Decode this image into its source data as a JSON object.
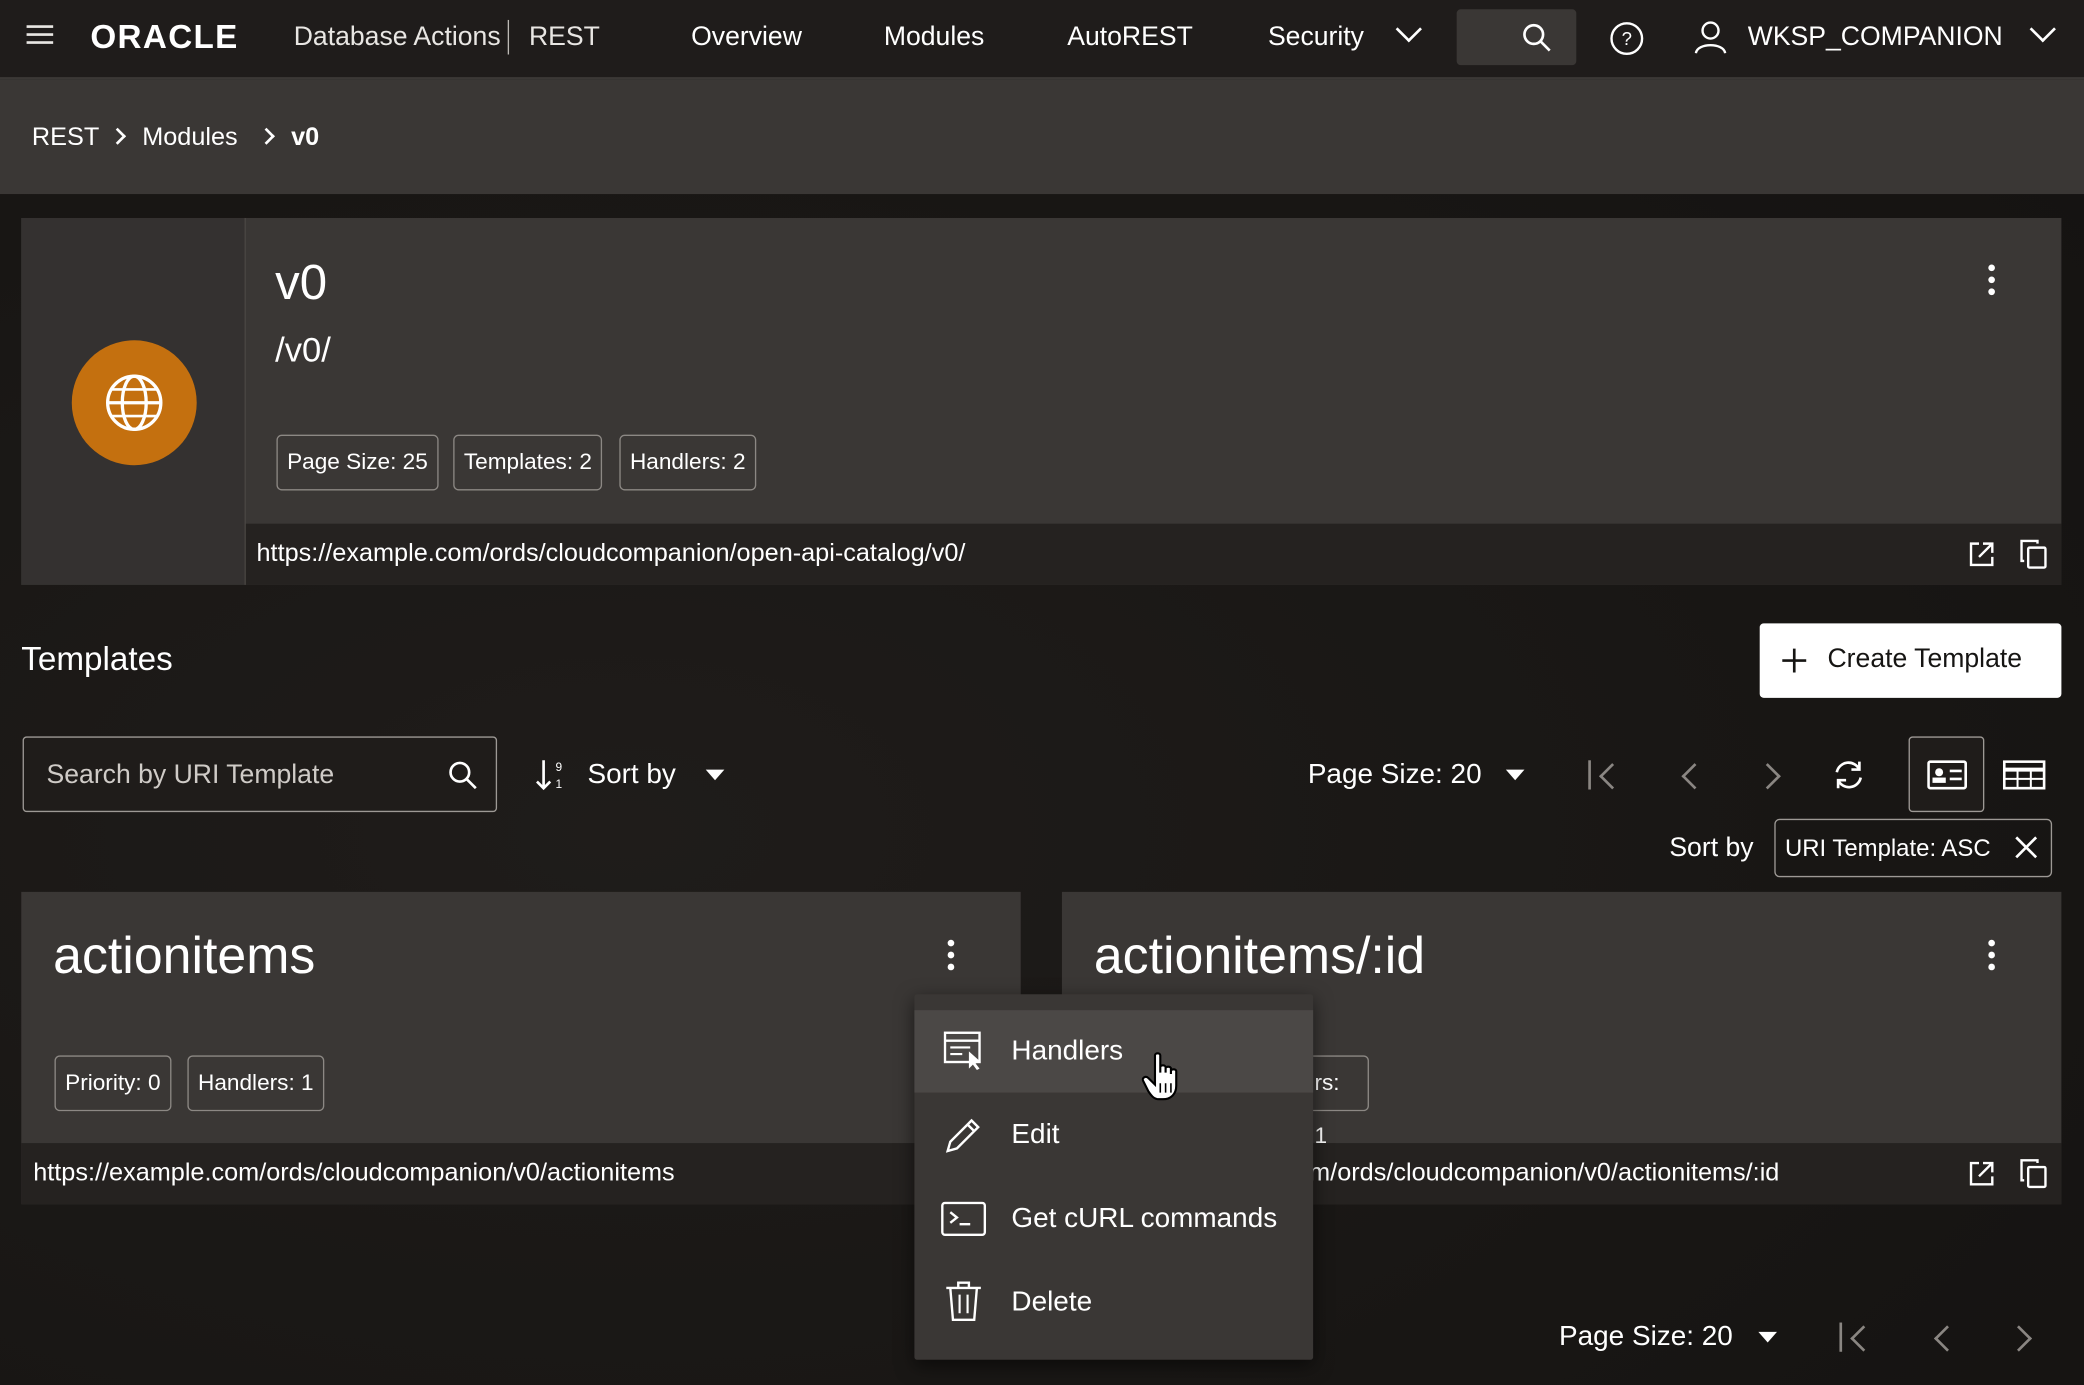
{
  "header": {
    "logo": "ORACLE",
    "product": "Database Actions",
    "app": "REST",
    "nav": [
      "Overview",
      "Modules",
      "AutoREST",
      "Security"
    ],
    "user": "WKSP_COMPANION"
  },
  "breadcrumb": [
    "REST",
    "Modules",
    "v0"
  ],
  "module": {
    "name": "v0",
    "path": "/v0/",
    "badges": [
      "Page Size: 25",
      "Templates: 2",
      "Handlers: 2"
    ],
    "url": "https://example.com/ords/cloudcompanion/open-api-catalog/v0/"
  },
  "templates": {
    "heading": "Templates",
    "create_label": "Create Template",
    "search_placeholder": "Search by URI Template",
    "sort_label": "Sort by",
    "page_size": "Page Size: 20",
    "sort_chip_label": "Sort by",
    "sort_chip_value": "URI Template: ASC",
    "cards": [
      {
        "title": "actionitems",
        "badges": [
          "Priority: 0",
          "Handlers: 1"
        ],
        "url": "https://example.com/ords/cloudcompanion/v0/actionitems"
      },
      {
        "title": "actionitems/:id",
        "badges": [
          "rs: 1"
        ],
        "url": "m/ords/cloudcompanion/v0/actionitems/:id"
      }
    ],
    "footer_page_size": "Page Size: 20"
  },
  "context_menu": {
    "items": [
      "Handlers",
      "Edit",
      "Get cURL commands",
      "Delete"
    ]
  },
  "colors": {
    "accent": "#c4700f",
    "card": "#3a3735",
    "header": "#1f1c1b"
  }
}
